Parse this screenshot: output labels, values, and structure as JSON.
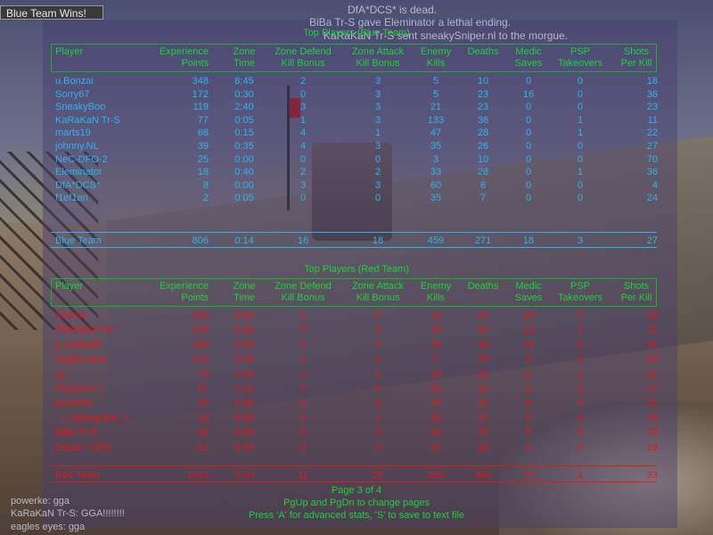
{
  "status": {
    "win_banner": "Blue Team Wins!",
    "kill_messages": [
      "DfA*DCS* is dead.",
      "BiBa Tr-S gave Eleminator a lethal ending.",
      "KaRaKaN Tr-S sent sneakySniper.nl to the morgue."
    ]
  },
  "columns": {
    "player": "Player",
    "experience": [
      "Experience",
      "Points"
    ],
    "zone_time": [
      "Zone",
      "Time"
    ],
    "zone_defend": [
      "Zone Defend",
      "Kill Bonus"
    ],
    "zone_attack": [
      "Zone Attack",
      "Kill Bonus"
    ],
    "enemy_kills": [
      "Enemy",
      "Kills"
    ],
    "deaths": "Deaths",
    "medic": [
      "Medic",
      "Saves"
    ],
    "psp": [
      "PSP",
      "Takeovers"
    ],
    "shots": [
      "Shots",
      "Per Kill"
    ]
  },
  "blue_team": {
    "title": "Top Players (Blue Team)",
    "rows": [
      {
        "player": "u.Bonzai",
        "xp": "348",
        "time": "8:45",
        "defend": "2",
        "attack": "3",
        "kills": "5",
        "deaths": "10",
        "medic": "0",
        "psp": "0",
        "shots": "18"
      },
      {
        "player": "Sorry67",
        "xp": "172",
        "time": "0:30",
        "defend": "0",
        "attack": "3",
        "kills": "5",
        "deaths": "23",
        "medic": "16",
        "psp": "0",
        "shots": "36"
      },
      {
        "player": "SneakyBoo",
        "xp": "119",
        "time": "2:40",
        "defend": "3",
        "attack": "3",
        "kills": "21",
        "deaths": "23",
        "medic": "0",
        "psp": "0",
        "shots": "23"
      },
      {
        "player": "KaRaKaN Tr-S",
        "xp": "77",
        "time": "0:05",
        "defend": "1",
        "attack": "3",
        "kills": "133",
        "deaths": "36",
        "medic": "0",
        "psp": "1",
        "shots": "11"
      },
      {
        "player": "marts19",
        "xp": "68",
        "time": "0:15",
        "defend": "4",
        "attack": "1",
        "kills": "47",
        "deaths": "28",
        "medic": "0",
        "psp": "1",
        "shots": "22"
      },
      {
        "player": "johnny.NL",
        "xp": "39",
        "time": "0:35",
        "defend": "4",
        "attack": "3",
        "kills": "35",
        "deaths": "26",
        "medic": "0",
        "psp": "0",
        "shots": "27"
      },
      {
        "player": "NeC-DFO-2",
        "xp": "25",
        "time": "0:00",
        "defend": "0",
        "attack": "0",
        "kills": "3",
        "deaths": "10",
        "medic": "0",
        "psp": "0",
        "shots": "70"
      },
      {
        "player": "Eleminator",
        "xp": "18",
        "time": "0:40",
        "defend": "2",
        "attack": "2",
        "kills": "33",
        "deaths": "28",
        "medic": "0",
        "psp": "1",
        "shots": "36"
      },
      {
        "player": "DfA*DCS*",
        "xp": "8",
        "time": "0:00",
        "defend": "3",
        "attack": "3",
        "kills": "60",
        "deaths": "6",
        "medic": "0",
        "psp": "0",
        "shots": "4"
      },
      {
        "player": "f1ef1an",
        "xp": "2",
        "time": "0:05",
        "defend": "0",
        "attack": "0",
        "kills": "35",
        "deaths": "7",
        "medic": "0",
        "psp": "0",
        "shots": "24"
      }
    ],
    "total": {
      "player": "Blue Team",
      "xp": "806",
      "time": "0:14",
      "defend": "16",
      "attack": "18",
      "kills": "459",
      "deaths": "271",
      "medic": "18",
      "psp": "3",
      "shots": "27"
    }
  },
  "red_team": {
    "title": "Top Players (Red Team)",
    "rows": [
      {
        "player": "Xtreme",
        "xp": "333",
        "time": "0:00",
        "defend": "0",
        "attack": "0",
        "kills": "14",
        "deaths": "41",
        "medic": "35",
        "psp": "0",
        "shots": "32"
      },
      {
        "player": "TRo0i68=TH=",
        "xp": "234",
        "time": "0:30",
        "defend": "3",
        "attack": "4",
        "kills": "15",
        "deaths": "42",
        "medic": "12",
        "psp": "1",
        "shots": "11"
      },
      {
        "player": "p_f1tRo68",
        "xp": "146",
        "time": "0:05",
        "defend": "1",
        "attack": "6",
        "kills": "28",
        "deaths": "39",
        "medic": "14",
        "psp": "0",
        "shots": "41"
      },
      {
        "player": "eagles eyes",
        "xp": "122",
        "time": "0:05",
        "defend": "1",
        "attack": "2",
        "kills": "7",
        "deaths": "23",
        "medic": "6",
        "psp": "0",
        "shots": "20"
      },
      {
        "player": "cy.",
        "xp": "78",
        "time": "0:00",
        "defend": "1",
        "attack": "4",
        "kills": "20",
        "deaths": "25",
        "medic": "0",
        "psp": "0",
        "shots": "31"
      },
      {
        "player": "FhEoOm-7",
        "xp": "67",
        "time": "0:10",
        "defend": "5",
        "attack": "8",
        "kills": "33",
        "deaths": "42",
        "medic": "0",
        "psp": "0",
        "shots": "27"
      },
      {
        "player": "powerke",
        "xp": "20",
        "time": "0:00",
        "defend": "0",
        "attack": "0",
        "kills": "19",
        "deaths": "20",
        "medic": "0",
        "psp": "0",
        "shots": "32"
      },
      {
        "player": "_+_Wrong Bet_+_",
        "xp": "16",
        "time": "0:00",
        "defend": "0",
        "attack": "1",
        "kills": "30",
        "deaths": "27",
        "medic": "0",
        "psp": "0",
        "shots": "42"
      },
      {
        "player": "BiBa Tr-S",
        "xp": "-16",
        "time": "0:00",
        "defend": "0",
        "attack": "0",
        "kills": "20",
        "deaths": "20",
        "medic": "0",
        "psp": "0",
        "shots": "20"
      },
      {
        "player": "Eraser -DFS-",
        "xp": "-21",
        "time": "0:00",
        "defend": "0",
        "attack": "0",
        "kills": "31",
        "deaths": "28",
        "medic": "0",
        "psp": "0",
        "shots": "19"
      }
    ],
    "total": {
      "player": "Red Team",
      "xp": "1019",
      "time": "0:00",
      "defend": "11",
      "attack": "25",
      "kills": "265",
      "deaths": "469",
      "medic": "74",
      "psp": "1",
      "shots": "33"
    }
  },
  "footer": {
    "page": "Page 3 of 4",
    "nav": "PgUp and PgDn to change pages",
    "hint": "Press 'A' for advanced stats, 'S' to save to text file"
  },
  "chat": [
    "powerke: gga",
    "KaRaKaN Tr-S: GGA!!!!!!!!",
    "eagles eyes: gga"
  ],
  "colors": {
    "header_green": "#19d436",
    "blue_team": "#2bb4f0",
    "red_team": "#e81515"
  }
}
